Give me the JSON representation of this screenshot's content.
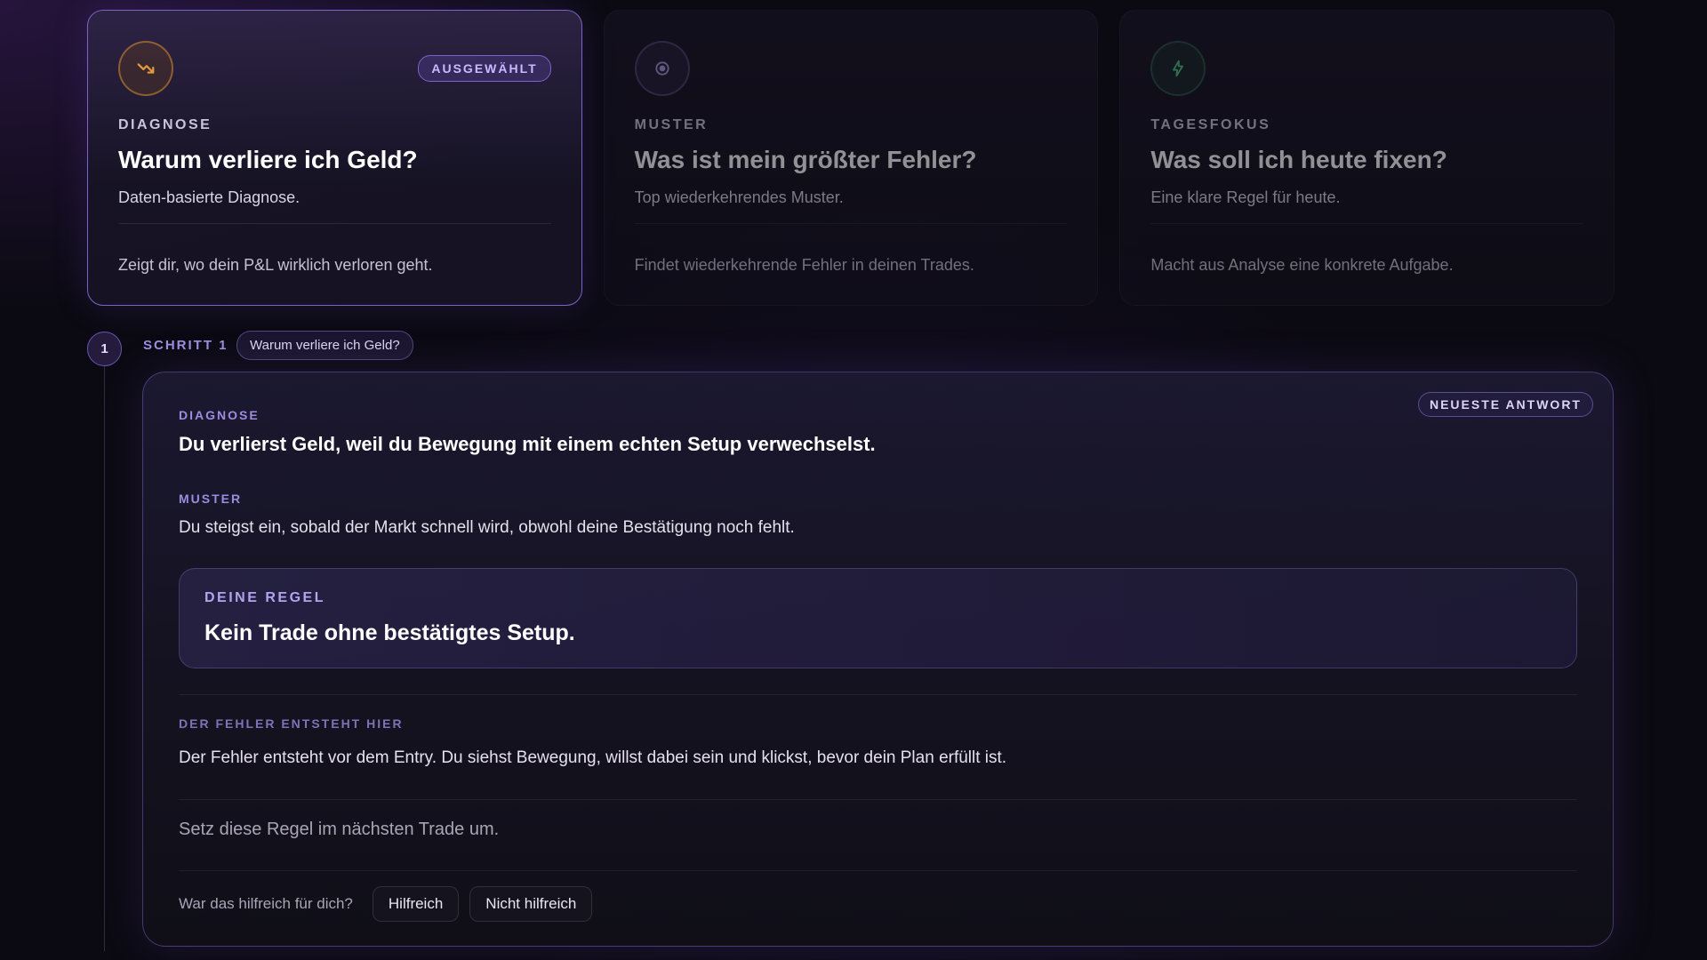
{
  "cards": [
    {
      "icon": "trending-down-icon",
      "badge": "AUSGEWÄHLT",
      "kicker": "DIAGNOSE",
      "title": "Warum verliere ich Geld?",
      "subtitle": "Daten-basierte Diagnose.",
      "description": "Zeigt dir, wo dein P&L wirklich verloren geht.",
      "selected": true
    },
    {
      "icon": "target-icon",
      "kicker": "MUSTER",
      "title": "Was ist mein größter Fehler?",
      "subtitle": "Top wiederkehrendes Muster.",
      "description": "Findet wiederkehrende Fehler in deinen Trades.",
      "selected": false
    },
    {
      "icon": "lightning-icon",
      "kicker": "TAGESFOKUS",
      "title": "Was soll ich heute fixen?",
      "subtitle": "Eine klare Regel für heute.",
      "description": "Macht aus Analyse eine konkrete Aufgabe.",
      "selected": false
    }
  ],
  "step": {
    "number": "1",
    "label": "SCHRITT 1",
    "question": "Warum verliere ich Geld?"
  },
  "answer": {
    "badge": "NEUESTE ANTWORT",
    "diagnose_kicker": "DIAGNOSE",
    "diagnose_text": "Du verlierst Geld, weil du Bewegung mit einem echten Setup verwechselst.",
    "muster_kicker": "MUSTER",
    "muster_text": "Du steigst ein, sobald der Markt schnell wird, obwohl deine Bestätigung noch fehlt.",
    "rule_kicker": "DEINE REGEL",
    "rule_text": "Kein Trade ohne bestätigtes Setup.",
    "fehler_kicker": "DER FEHLER ENTSTEHT HIER",
    "fehler_text": "Der Fehler entsteht vor dem Entry. Du siehst Bewegung, willst dabei sein und klickst, bevor dein Plan erfüllt ist.",
    "apply_text": "Setz diese Regel im nächsten Trade um.",
    "feedback_question": "War das hilfreich für dich?",
    "helpful_label": "Hilfreich",
    "not_helpful_label": "Nicht hilfreich"
  },
  "colors": {
    "accent": "#7a63c9",
    "background": "#0b0a12",
    "orange_icon": "#e59a3a",
    "green_icon": "#4fc27f"
  }
}
